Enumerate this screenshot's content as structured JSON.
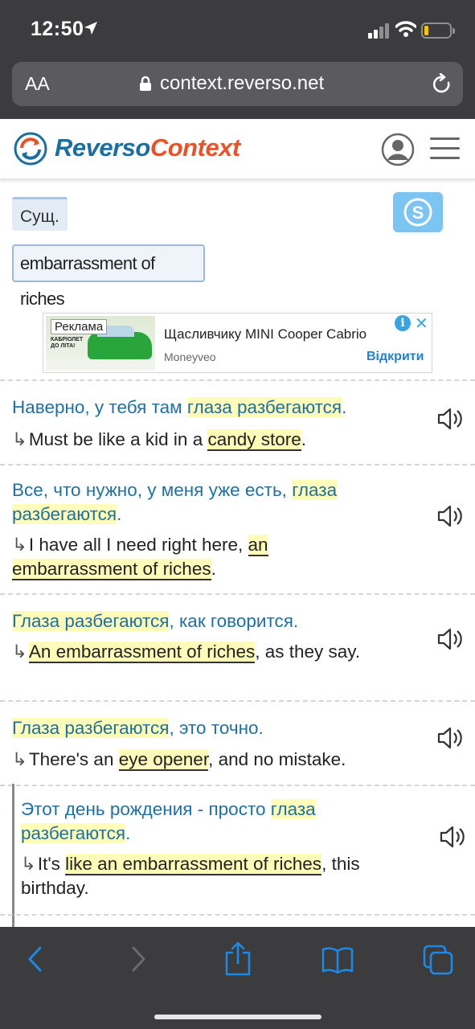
{
  "status": {
    "time": "12:50"
  },
  "browser": {
    "text_size_label": "AA",
    "url": "context.reverso.net"
  },
  "site": {
    "logo_part1": "Reverso",
    "logo_part2": "Context"
  },
  "tags": {
    "pos": "Сущ.",
    "phrase": "embarrassment of riches"
  },
  "ad": {
    "label": "Реклама",
    "image_text": "КАБРІОЛЕТ ДО ЛІТА!",
    "title": "Щасливчику MINI Cooper Cabrio",
    "brand": "Moneyveo",
    "cta": "Відкрити",
    "info": "i",
    "close": "✕"
  },
  "examples": [
    {
      "src": [
        [
          "Наверно, у тебя там ",
          false
        ],
        [
          "глаза разбегаются",
          true
        ],
        [
          ".",
          false
        ]
      ],
      "tgt": [
        [
          "Must be like a kid in a ",
          false
        ],
        [
          "candy store",
          true
        ],
        [
          ".",
          false
        ]
      ]
    },
    {
      "src": [
        [
          "Все, что нужно, у меня уже есть, ",
          false
        ],
        [
          "глаза разбегаются",
          true
        ],
        [
          ".",
          false
        ]
      ],
      "tgt": [
        [
          "I have all I need right here, ",
          false
        ],
        [
          "an embarrassment of riches",
          true
        ],
        [
          ".",
          false
        ]
      ]
    },
    {
      "src": [
        [
          "Глаза разбегаются",
          true
        ],
        [
          ", как говорится.",
          false
        ]
      ],
      "tgt": [
        [
          "An embarrassment of riches",
          true
        ],
        [
          ", as they say.",
          false
        ]
      ]
    },
    {
      "src": [
        [
          "Глаза разбегаются",
          true
        ],
        [
          ", это точно.",
          false
        ]
      ],
      "tgt": [
        [
          "There's an ",
          false
        ],
        [
          "eye opener",
          true
        ],
        [
          ", and no mistake.",
          false
        ]
      ]
    },
    {
      "src": [
        [
          "Этот день рождения - просто ",
          false
        ],
        [
          "глаза разбегаются",
          true
        ],
        [
          ".",
          false
        ]
      ],
      "tgt": [
        [
          "It's ",
          false
        ],
        [
          "like an embarrassment of riches",
          true
        ],
        [
          ", this birthday.",
          false
        ]
      ]
    }
  ],
  "colors": {
    "source_text": "#1f6fa0",
    "highlight": "#fffbb8",
    "logo_blue": "#1a6fa0",
    "logo_orange": "#e8532a",
    "browser_chrome": "#3c3c3e"
  }
}
